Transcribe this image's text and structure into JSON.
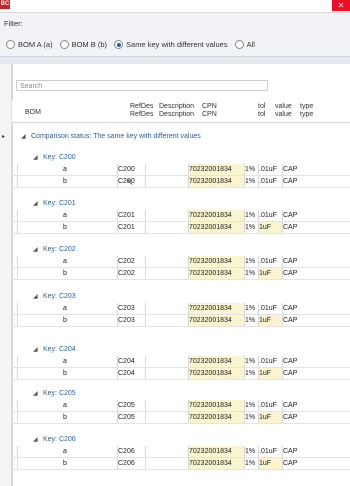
{
  "title": {
    "app_icon": "BC",
    "close": "✕"
  },
  "filter": {
    "label": "Filter:",
    "options": [
      {
        "label": "BOM A (a)",
        "selected": false
      },
      {
        "label": "BOM B (b)",
        "selected": false
      },
      {
        "label": "Same key with different values",
        "selected": true
      },
      {
        "label": "All",
        "selected": false
      }
    ]
  },
  "search": {
    "placeholder": "Search"
  },
  "headers": {
    "bom": "BOM",
    "refdes": "RefDes",
    "description": "Description",
    "cpn": "CPN",
    "tol": "tol",
    "value": "value",
    "type": "type"
  },
  "comparison_status": "Comparison status: The same key with different values",
  "groups": [
    {
      "key": "Key: C200",
      "rows": [
        {
          "bom": "a",
          "refdes": "C200",
          "cpn": "70232001834",
          "tol": "1%",
          "value": ".01uF",
          "type": "CAP"
        },
        {
          "bom": "b",
          "refdes": "C200",
          "cpn": "70232001834",
          "tol": "1%",
          "value": ".01uF",
          "type": "CAP"
        }
      ]
    },
    {
      "key": "Key: C201",
      "rows": [
        {
          "bom": "a",
          "refdes": "C201",
          "cpn": "70232001834",
          "tol": "1%",
          "value": ".01uF",
          "type": "CAP"
        },
        {
          "bom": "b",
          "refdes": "C201",
          "cpn": "70232001834",
          "tol": "1%",
          "value": "1uF",
          "type": "CAP"
        }
      ]
    },
    {
      "key": "Key: C202",
      "rows": [
        {
          "bom": "a",
          "refdes": "C202",
          "cpn": "70232001834",
          "tol": "1%",
          "value": ".01uF",
          "type": "CAP"
        },
        {
          "bom": "b",
          "refdes": "C202",
          "cpn": "70232001834",
          "tol": "1%",
          "value": "1uF",
          "type": "CAP"
        }
      ]
    },
    {
      "key": "Key: C203",
      "rows": [
        {
          "bom": "a",
          "refdes": "C203",
          "cpn": "70232001834",
          "tol": "1%",
          "value": ".01uF",
          "type": "CAP"
        },
        {
          "bom": "b",
          "refdes": "C203",
          "cpn": "70232001834",
          "tol": "1%",
          "value": "1uF",
          "type": "CAP"
        }
      ]
    },
    {
      "key": "Key: C204",
      "rows": [
        {
          "bom": "a",
          "refdes": "C204",
          "cpn": "70232001834",
          "tol": "1%",
          "value": ".01uF",
          "type": "CAP"
        },
        {
          "bom": "b",
          "refdes": "C204",
          "cpn": "70232001834",
          "tol": "1%",
          "value": "1uF",
          "type": "CAP"
        }
      ]
    },
    {
      "key": "Key: C205",
      "rows": [
        {
          "bom": "a",
          "refdes": "C205",
          "cpn": "70232001834",
          "tol": "1%",
          "value": ".01uF",
          "type": "CAP"
        },
        {
          "bom": "b",
          "refdes": "C205",
          "cpn": "70232001834",
          "tol": "1%",
          "value": "1uF",
          "type": "CAP"
        }
      ]
    },
    {
      "key": "Key: C206",
      "rows": [
        {
          "bom": "a",
          "refdes": "C206",
          "cpn": "70232001834",
          "tol": "1%",
          "value": ".01uF",
          "type": "CAP"
        },
        {
          "bom": "b",
          "refdes": "C206",
          "cpn": "70232001834",
          "tol": "1%",
          "value": "1uF",
          "type": "CAP"
        }
      ]
    }
  ],
  "colors": {
    "highlight": "#fbf5cf",
    "group_text": "#2f5f96"
  }
}
